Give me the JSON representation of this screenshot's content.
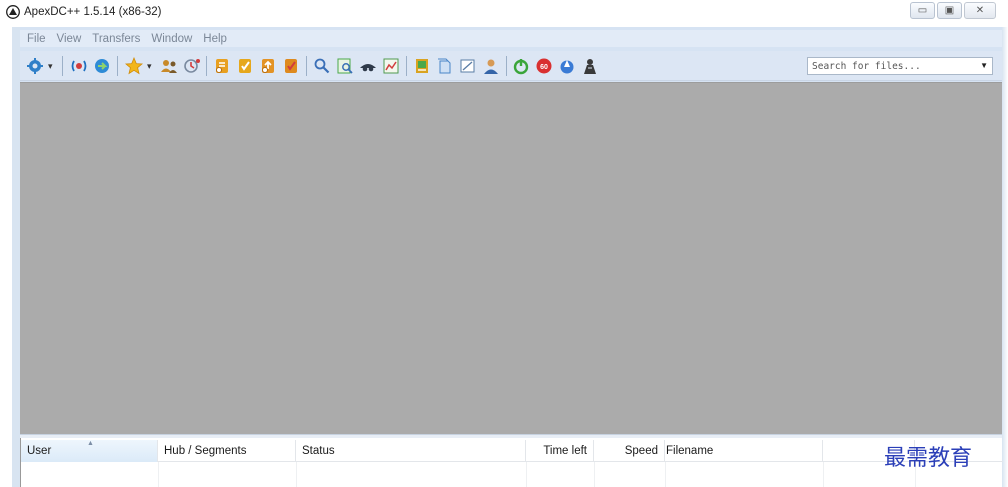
{
  "window": {
    "title": "ApexDC++ 1.5.14 (x86-32)",
    "controls": {
      "minimize": "▭",
      "maximize": "▣",
      "close": "✕"
    }
  },
  "menu": {
    "items": [
      "File",
      "View",
      "Transfers",
      "Window",
      "Help"
    ]
  },
  "toolbar": {
    "buttons": [
      {
        "name": "connect-icon",
        "color": "#2f7fc8"
      },
      {
        "name": "reconnect-icon",
        "color": "#1e6fc0"
      },
      {
        "name": "follow-redirect-icon",
        "color": "#2e8bd6"
      },
      {
        "name": "favorites-star-icon",
        "color": "#f2b61b"
      },
      {
        "name": "favorite-users-icon",
        "color": "#c88a2a"
      },
      {
        "name": "recent-hubs-icon",
        "color": "#7a8aa0"
      },
      {
        "name": "queue-icon",
        "color": "#e8a020"
      },
      {
        "name": "finished-downloads-icon",
        "color": "#e6a81c"
      },
      {
        "name": "upload-queue-icon",
        "color": "#e39325"
      },
      {
        "name": "finished-uploads-icon",
        "color": "#de8a1e"
      },
      {
        "name": "search-icon",
        "color": "#3a6fb7"
      },
      {
        "name": "adl-search-icon",
        "color": "#4aa84a"
      },
      {
        "name": "search-spy-icon",
        "color": "#2f3a4a"
      },
      {
        "name": "network-stats-icon",
        "color": "#4f9a4f"
      },
      {
        "name": "open-filelist-icon",
        "color": "#d9a321"
      },
      {
        "name": "recents-icon",
        "color": "#4a86c8"
      },
      {
        "name": "notepad-icon",
        "color": "#5a7da6"
      },
      {
        "name": "system-log-icon",
        "color": "#3565a8"
      },
      {
        "name": "away-power-icon",
        "color": "#3aa53a"
      },
      {
        "name": "limiter-icon",
        "color": "#d93030"
      },
      {
        "name": "cdm-icon",
        "color": "#3a7bd5"
      },
      {
        "name": "settings-user-icon",
        "color": "#3a3a3a"
      }
    ],
    "search": {
      "placeholder": "Search for files..."
    }
  },
  "transfers": {
    "columns": [
      "User",
      "Hub / Segments",
      "Status",
      "Time left",
      "Speed",
      "Filename"
    ]
  },
  "watermark": "最需教育"
}
